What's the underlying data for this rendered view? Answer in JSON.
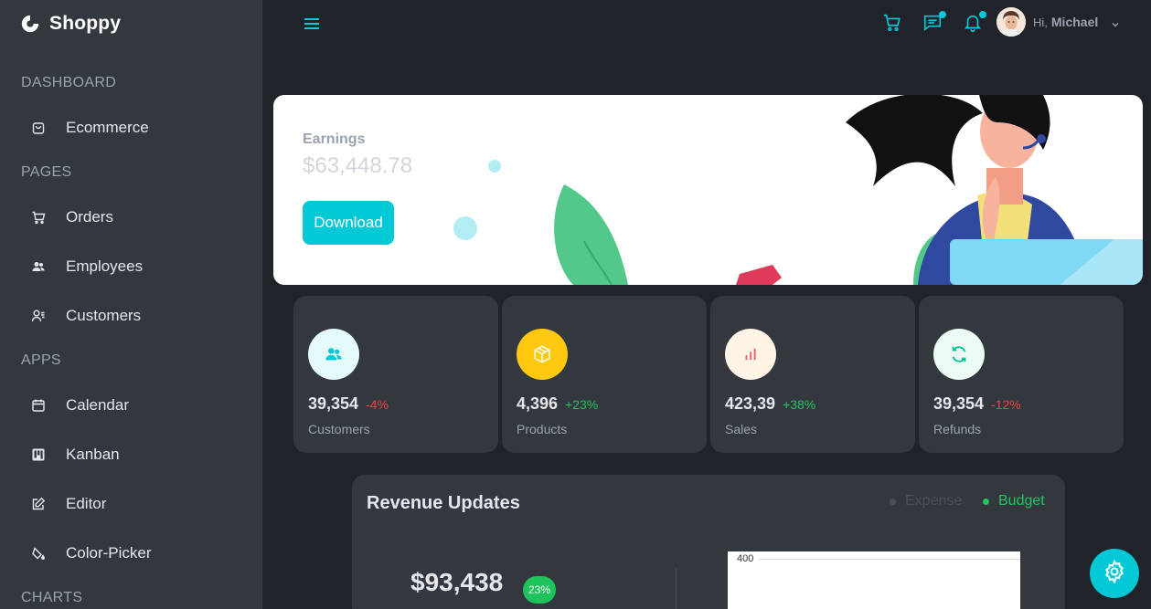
{
  "brand": {
    "name": "Shoppy"
  },
  "sidebar": {
    "sections": [
      {
        "title": "DASHBOARD",
        "items": [
          {
            "label": "Ecommerce",
            "icon": "shopping-bag-icon"
          }
        ]
      },
      {
        "title": "PAGES",
        "items": [
          {
            "label": "Orders",
            "icon": "cart-icon"
          },
          {
            "label": "Employees",
            "icon": "people-icon"
          },
          {
            "label": "Customers",
            "icon": "user-list-icon"
          }
        ]
      },
      {
        "title": "APPS",
        "items": [
          {
            "label": "Calendar",
            "icon": "calendar-icon"
          },
          {
            "label": "Kanban",
            "icon": "kanban-icon"
          },
          {
            "label": "Editor",
            "icon": "edit-icon"
          },
          {
            "label": "Color-Picker",
            "icon": "paint-bucket-icon"
          }
        ]
      },
      {
        "title": "CHARTS",
        "items": []
      }
    ]
  },
  "topbar": {
    "greeting": "Hi,",
    "username": "Michael",
    "icons": [
      "menu-icon",
      "cart-icon",
      "chat-icon",
      "bell-icon",
      "chevron-down-icon"
    ]
  },
  "earnings": {
    "label": "Earnings",
    "value": "$63,448.78",
    "button": "Download"
  },
  "stats": [
    {
      "value": "39,354",
      "change": "-4%",
      "title": "Customers",
      "icon": "customers-icon",
      "icon_bg": "#e5fafb",
      "icon_color": "#03c9d7",
      "change_color": "#ef4444"
    },
    {
      "value": "4,396",
      "change": "+23%",
      "title": "Products",
      "icon": "box-icon",
      "icon_bg": "#fec90f",
      "icon_color": "#ffffff",
      "change_color": "#22c55e"
    },
    {
      "value": "423,39",
      "change": "+38%",
      "title": "Sales",
      "icon": "bar-chart-icon",
      "icon_bg": "#fff4e5",
      "icon_color": "#e46a76",
      "change_color": "#22c55e"
    },
    {
      "value": "39,354",
      "change": "-12%",
      "title": "Refunds",
      "icon": "refresh-icon",
      "icon_bg": "#ebfaf2",
      "icon_color": "#00c292",
      "change_color": "#ef4444"
    }
  ],
  "revenue": {
    "title": "Revenue Updates",
    "legend": [
      {
        "label": "Expense",
        "color": "#4b5058"
      },
      {
        "label": "Budget",
        "color": "#22c55e"
      }
    ],
    "amount": "$93,438",
    "badge": "23%",
    "chart_tick": "400"
  },
  "colors": {
    "accent": "#03c9d7",
    "sidebar_bg": "#33373e",
    "main_bg": "#20232a"
  }
}
